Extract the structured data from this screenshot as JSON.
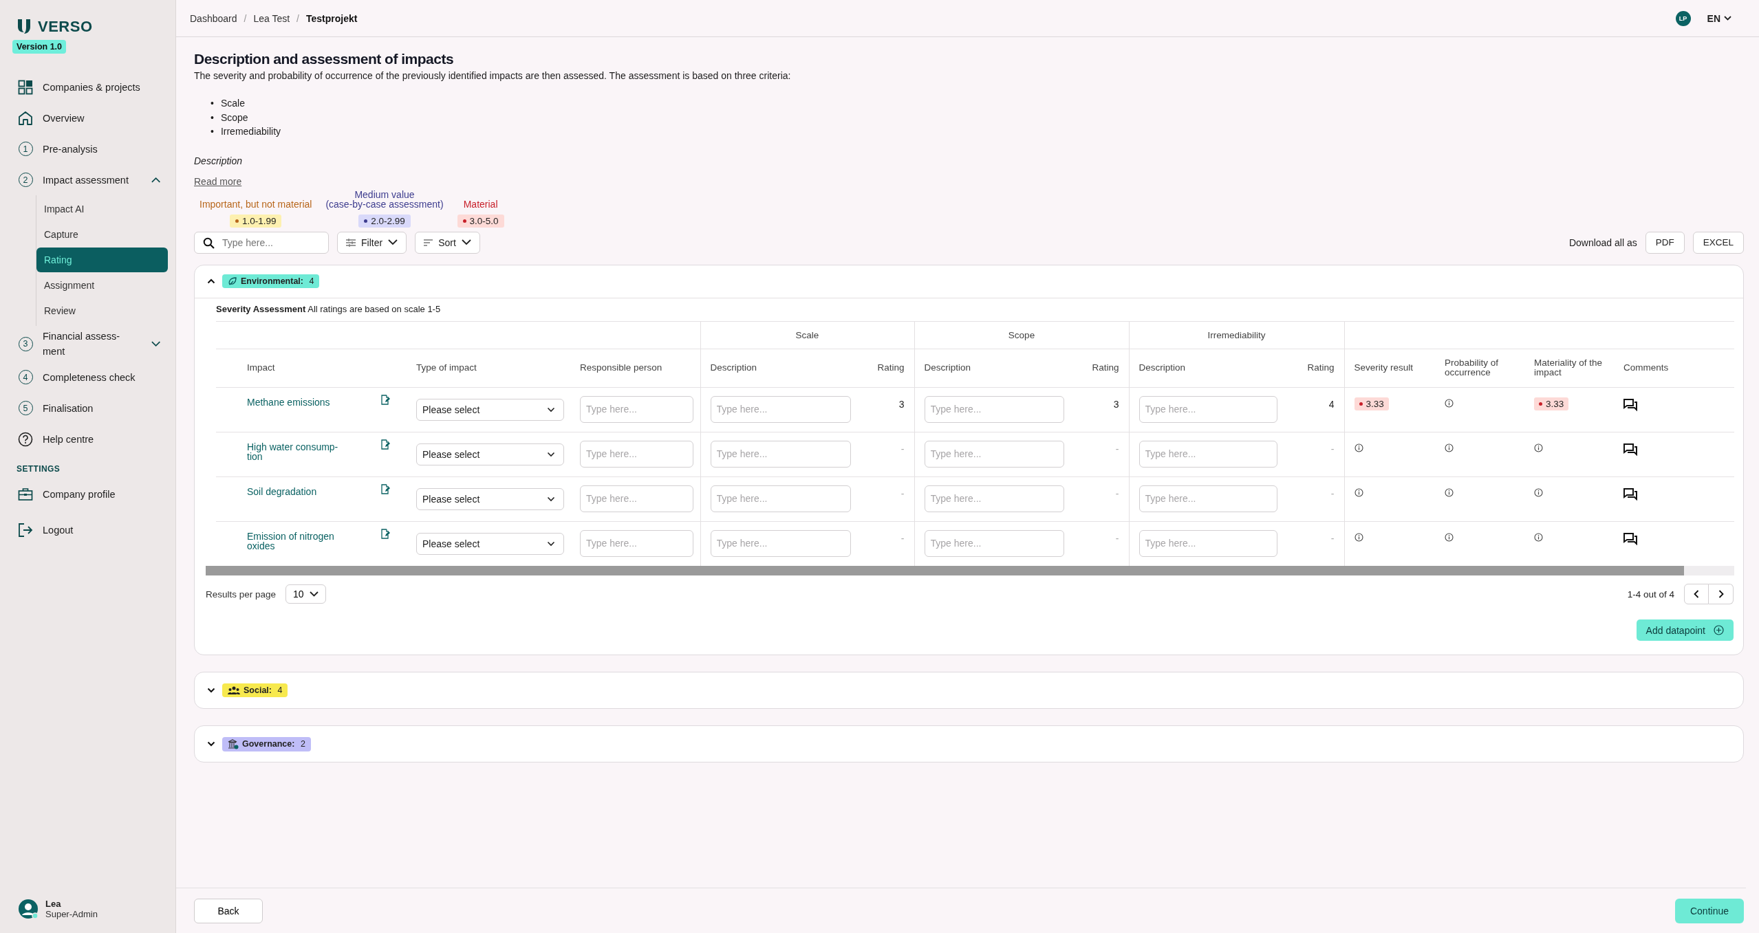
{
  "sidebar": {
    "logo": "VERSO",
    "version": "Version 1.0",
    "items": [
      {
        "kind": "companies",
        "label": "Companies & projects"
      },
      {
        "kind": "overview",
        "label": "Overview"
      },
      {
        "kind": "step",
        "number": "1",
        "label": "Pre-analysis"
      },
      {
        "kind": "step",
        "number": "2",
        "label": "Impact assessment",
        "expanded": true,
        "children": [
          {
            "label": "Impact AI",
            "selected": false
          },
          {
            "label": "Capture",
            "selected": false
          },
          {
            "label": "Rating",
            "selected": true
          },
          {
            "label": "Assignment",
            "selected": false
          },
          {
            "label": "Review",
            "selected": false
          }
        ]
      },
      {
        "kind": "step",
        "number": "3",
        "label": "Financial assess-\nment",
        "expanded": false
      },
      {
        "kind": "step",
        "number": "4",
        "label": "Completeness check"
      },
      {
        "kind": "step",
        "number": "5",
        "label": "Finalisation"
      },
      {
        "kind": "help",
        "label": "Help centre"
      }
    ],
    "settings_heading": "SETTINGS",
    "settings_items": [
      {
        "kind": "profile",
        "label": "Company profile"
      },
      {
        "kind": "logout",
        "label": "Logout"
      }
    ],
    "user": {
      "name": "Lea",
      "role": "Super-Admin"
    }
  },
  "header": {
    "separator": "/",
    "breadcrumbs": [
      {
        "label": "Dashboard",
        "current": false
      },
      {
        "label": "Lea Test",
        "current": false
      },
      {
        "label": "Testprojekt",
        "current": true
      }
    ],
    "avatar": "LP",
    "language": "EN"
  },
  "page": {
    "title": "Description and assessment of impacts",
    "intro": "The severity and probability of occurrence of the previously identified impacts are then assessed. The assessment is based on three criteria:",
    "bullet": "•",
    "criteria": [
      "Scale",
      "Scope",
      "Irremediability"
    ],
    "description_label": "Description",
    "read_more": "Read more",
    "legend": [
      {
        "label": "Important, but not material",
        "range": "1.0-1.99",
        "color": "#b8671c"
      },
      {
        "label": "Medium value\n(case-by-case assessment)",
        "range": "2.0-2.99",
        "color": "#3e3d8f"
      },
      {
        "label": "Material",
        "range": "3.0-5.0",
        "color": "#c8202a"
      }
    ],
    "search": {
      "placeholder": "Type here..."
    },
    "filter": "Filter",
    "sort": "Sort",
    "download_label": "Download all as",
    "download_buttons": [
      "PDF",
      "EXCEL"
    ]
  },
  "categories": [
    {
      "kind": "environmental",
      "label": "Environmental:",
      "count": "4",
      "expanded": true,
      "table": {
        "note_bold": "Severity Assessment",
        "note": "All ratings are based on scale 1-5",
        "groups": [
          "Scale",
          "Scope",
          "Irremediability"
        ],
        "columns": [
          "Impact",
          "Type of impact",
          "Responsible person",
          "Description",
          "Rating",
          "Description",
          "Rating",
          "Description",
          "Rating",
          "Severity result",
          "Probability of occurrence",
          "Materiality of the impact",
          "Comments"
        ],
        "rows": [
          {
            "impact": "Methane emissions",
            "type": "Please select",
            "responsible_placeholder": "Type here...",
            "criteria": [
              {
                "placeholder": "Type here...",
                "rating": "3"
              },
              {
                "placeholder": "Type here...",
                "rating": "3"
              },
              {
                "placeholder": "Type here...",
                "rating": "4"
              }
            ],
            "severity": "3.33",
            "materiality": "3.33"
          },
          {
            "impact": "High water consump-\ntion",
            "type": "Please select",
            "responsible_placeholder": "Type here...",
            "criteria": [
              {
                "placeholder": "Type here...",
                "rating": "-"
              },
              {
                "placeholder": "Type here...",
                "rating": "-"
              },
              {
                "placeholder": "Type here...",
                "rating": "-"
              }
            ]
          },
          {
            "impact": "Soil degradation",
            "type": "Please select",
            "responsible_placeholder": "Type here...",
            "criteria": [
              {
                "placeholder": "Type here...",
                "rating": "-"
              },
              {
                "placeholder": "Type here...",
                "rating": "-"
              },
              {
                "placeholder": "Type here...",
                "rating": "-"
              }
            ]
          },
          {
            "impact": "Emission of nitrogen oxides",
            "type": "Please select",
            "responsible_placeholder": "Type here...",
            "criteria": [
              {
                "placeholder": "Type here...",
                "rating": "-"
              },
              {
                "placeholder": "Type here...",
                "rating": "-"
              },
              {
                "placeholder": "Type here...",
                "rating": "-"
              }
            ]
          }
        ],
        "results_label": "Results per page",
        "per_page": "10",
        "range": "1-4 out of 4",
        "add_button": "Add datapoint"
      }
    },
    {
      "kind": "social",
      "label": "Social:",
      "count": "4",
      "expanded": false
    },
    {
      "kind": "governance",
      "label": "Governance:",
      "count": "2",
      "expanded": false
    }
  ],
  "footer": {
    "back": "Back",
    "continue": "Continue"
  }
}
